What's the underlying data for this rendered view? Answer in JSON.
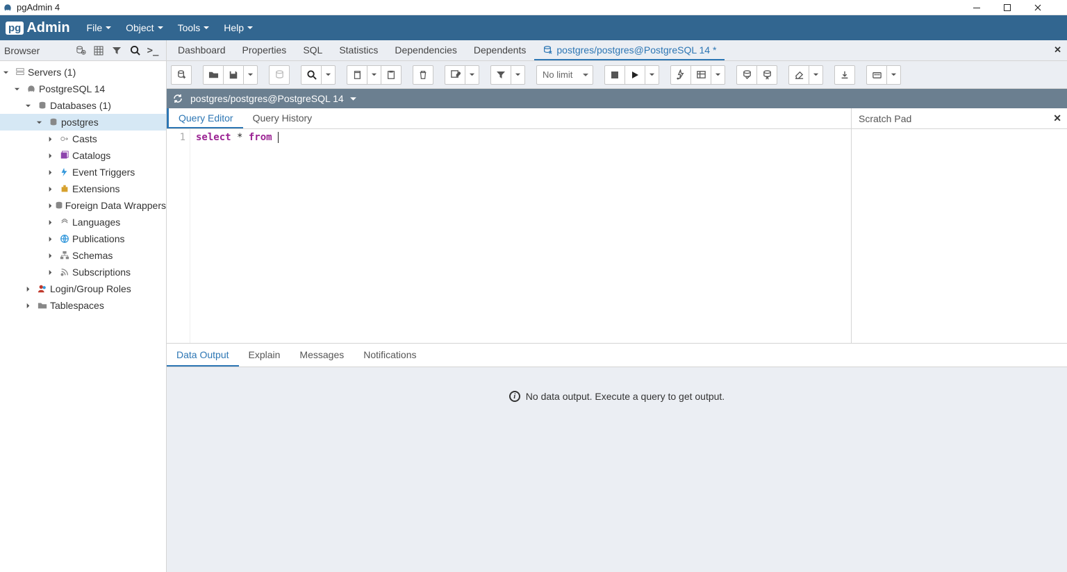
{
  "window": {
    "title": "pgAdmin 4"
  },
  "brand": {
    "pg": "pg",
    "admin": "Admin"
  },
  "menus": [
    {
      "label": "File"
    },
    {
      "label": "Object"
    },
    {
      "label": "Tools"
    },
    {
      "label": "Help"
    }
  ],
  "browser": {
    "title": "Browser",
    "tree": {
      "servers": "Servers (1)",
      "server": "PostgreSQL 14",
      "databases": "Databases (1)",
      "database": "postgres",
      "children": [
        "Casts",
        "Catalogs",
        "Event Triggers",
        "Extensions",
        "Foreign Data Wrappers",
        "Languages",
        "Publications",
        "Schemas",
        "Subscriptions"
      ],
      "login": "Login/Group Roles",
      "tablespaces": "Tablespaces"
    }
  },
  "main_tabs": [
    {
      "label": "Dashboard"
    },
    {
      "label": "Properties"
    },
    {
      "label": "SQL"
    },
    {
      "label": "Statistics"
    },
    {
      "label": "Dependencies"
    },
    {
      "label": "Dependents"
    },
    {
      "label": "postgres/postgres@PostgreSQL 14 *",
      "active": true
    }
  ],
  "toolbar": {
    "limit": "No limit"
  },
  "connection": {
    "label": "postgres/postgres@PostgreSQL 14"
  },
  "editor": {
    "tabs": {
      "editor": "Query Editor",
      "history": "Query History"
    },
    "line_no": "1",
    "kw_select": "select",
    "star": " * ",
    "kw_from": "from",
    "trail": " "
  },
  "scratch": {
    "title": "Scratch Pad"
  },
  "output": {
    "tabs": [
      "Data Output",
      "Explain",
      "Messages",
      "Notifications"
    ],
    "empty": "No data output. Execute a query to get output."
  }
}
